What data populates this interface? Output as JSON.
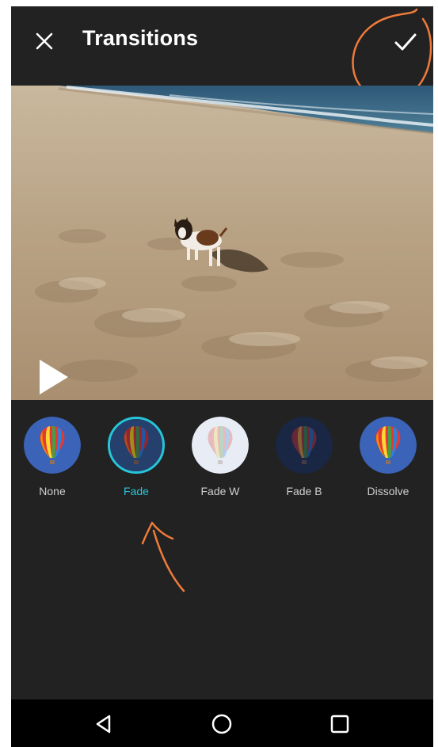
{
  "header": {
    "title": "Transitions",
    "close_icon": "close-icon",
    "confirm_icon": "checkmark-icon"
  },
  "preview": {
    "play_icon": "play-icon"
  },
  "transitions": {
    "selected": "Fade",
    "items": [
      {
        "label": "None",
        "style": "none"
      },
      {
        "label": "Fade",
        "style": "fade"
      },
      {
        "label": "Fade W",
        "style": "fade-white"
      },
      {
        "label": "Fade B",
        "style": "fade-black"
      },
      {
        "label": "Dissolve",
        "style": "dissolve"
      }
    ]
  },
  "navbar": {
    "back_icon": "back-triangle-icon",
    "home_icon": "home-circle-icon",
    "recents_icon": "recents-square-icon"
  },
  "colors": {
    "background": "#222222",
    "accent": "#26c6da",
    "annotation": "#f07b3a"
  }
}
